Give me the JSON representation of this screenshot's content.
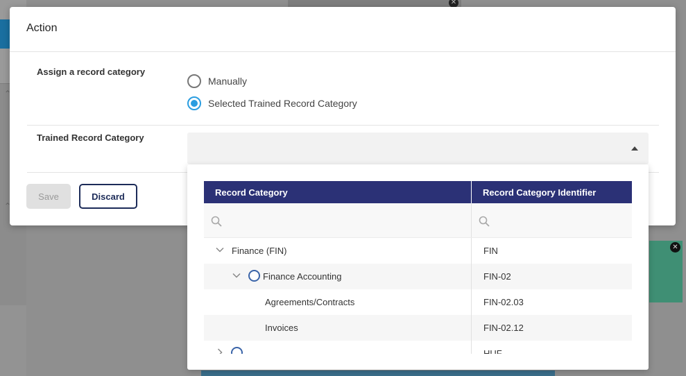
{
  "modal": {
    "title": "Action",
    "assign": {
      "label": "Assign a record category",
      "options": [
        {
          "label": "Manually",
          "checked": false
        },
        {
          "label": "Selected Trained Record Category",
          "checked": true
        }
      ]
    },
    "trained": {
      "label": "Trained Record Category",
      "value": ""
    },
    "buttons": {
      "save": "Save",
      "discard": "Discard"
    }
  },
  "dropdown": {
    "columns": [
      "Record Category",
      "Record Category Identifier"
    ],
    "search_placeholders": [
      "",
      ""
    ],
    "rows": [
      {
        "name": "Finance (FIN)",
        "id": "FIN",
        "level": 0,
        "expanded": true,
        "has_radio": false
      },
      {
        "name": "Finance Accounting",
        "id": "FIN-02",
        "level": 1,
        "expanded": true,
        "has_radio": true
      },
      {
        "name": "Agreements/Contracts",
        "id": "FIN-02.03",
        "level": 2,
        "expanded": false,
        "has_radio": false
      },
      {
        "name": "Invoices",
        "id": "FIN-02.12",
        "level": 2,
        "expanded": false,
        "has_radio": false
      },
      {
        "name": "",
        "id": "HUF",
        "level": 0,
        "expanded": false,
        "has_radio": true
      }
    ]
  },
  "colors": {
    "header_bg": "#2b3176",
    "radio_accent": "#2a9de0",
    "discard_border": "#1c2b58",
    "tree_radio": "#3a64a8"
  }
}
